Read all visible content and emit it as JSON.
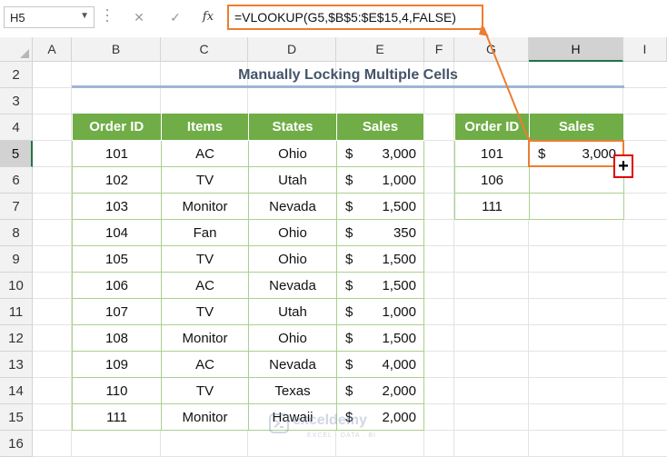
{
  "formula_bar": {
    "name_box": "H5",
    "cancel_icon": "✕",
    "enter_icon": "✓",
    "fx_label": "fx",
    "formula": "=VLOOKUP(G5,$B$5:$E$15,4,FALSE)"
  },
  "columns": [
    "A",
    "B",
    "C",
    "D",
    "E",
    "F",
    "G",
    "H",
    "I"
  ],
  "selected_column": "H",
  "rows": [
    "2",
    "3",
    "4",
    "5",
    "6",
    "7",
    "8",
    "9",
    "10",
    "11",
    "12",
    "13",
    "14",
    "15",
    "16"
  ],
  "selected_row": "5",
  "title": "Manually Locking Multiple Cells",
  "main_table": {
    "headers": [
      "Order ID",
      "Items",
      "States",
      "Sales"
    ],
    "currency": "$",
    "rows": [
      {
        "id": "101",
        "item": "AC",
        "state": "Ohio",
        "sales": "3,000"
      },
      {
        "id": "102",
        "item": "TV",
        "state": "Utah",
        "sales": "1,000"
      },
      {
        "id": "103",
        "item": "Monitor",
        "state": "Nevada",
        "sales": "1,500"
      },
      {
        "id": "104",
        "item": "Fan",
        "state": "Ohio",
        "sales": "350"
      },
      {
        "id": "105",
        "item": "TV",
        "state": "Ohio",
        "sales": "1,500"
      },
      {
        "id": "106",
        "item": "AC",
        "state": "Nevada",
        "sales": "1,500"
      },
      {
        "id": "107",
        "item": "TV",
        "state": "Utah",
        "sales": "1,000"
      },
      {
        "id": "108",
        "item": "Monitor",
        "state": "Ohio",
        "sales": "1,500"
      },
      {
        "id": "109",
        "item": "AC",
        "state": "Nevada",
        "sales": "4,000"
      },
      {
        "id": "110",
        "item": "TV",
        "state": "Texas",
        "sales": "2,000"
      },
      {
        "id": "111",
        "item": "Monitor",
        "state": "Hawaii",
        "sales": "2,000"
      }
    ]
  },
  "lookup_table": {
    "headers": [
      "Order ID",
      "Sales"
    ],
    "rows": [
      {
        "id": "101",
        "currency": "$",
        "sales": "3,000"
      },
      {
        "id": "106",
        "currency": "",
        "sales": ""
      },
      {
        "id": "111",
        "currency": "",
        "sales": ""
      }
    ]
  },
  "fill_handle_icon": "+",
  "watermark": {
    "name": "exceldemy",
    "tagline": "EXCEL · DATA · BI"
  },
  "colors": {
    "header_green": "#70ad47",
    "border_green": "#a9d08e",
    "accent_orange": "#ed7d31",
    "fill_handle_red": "#e00000",
    "title_text": "#44546a"
  }
}
